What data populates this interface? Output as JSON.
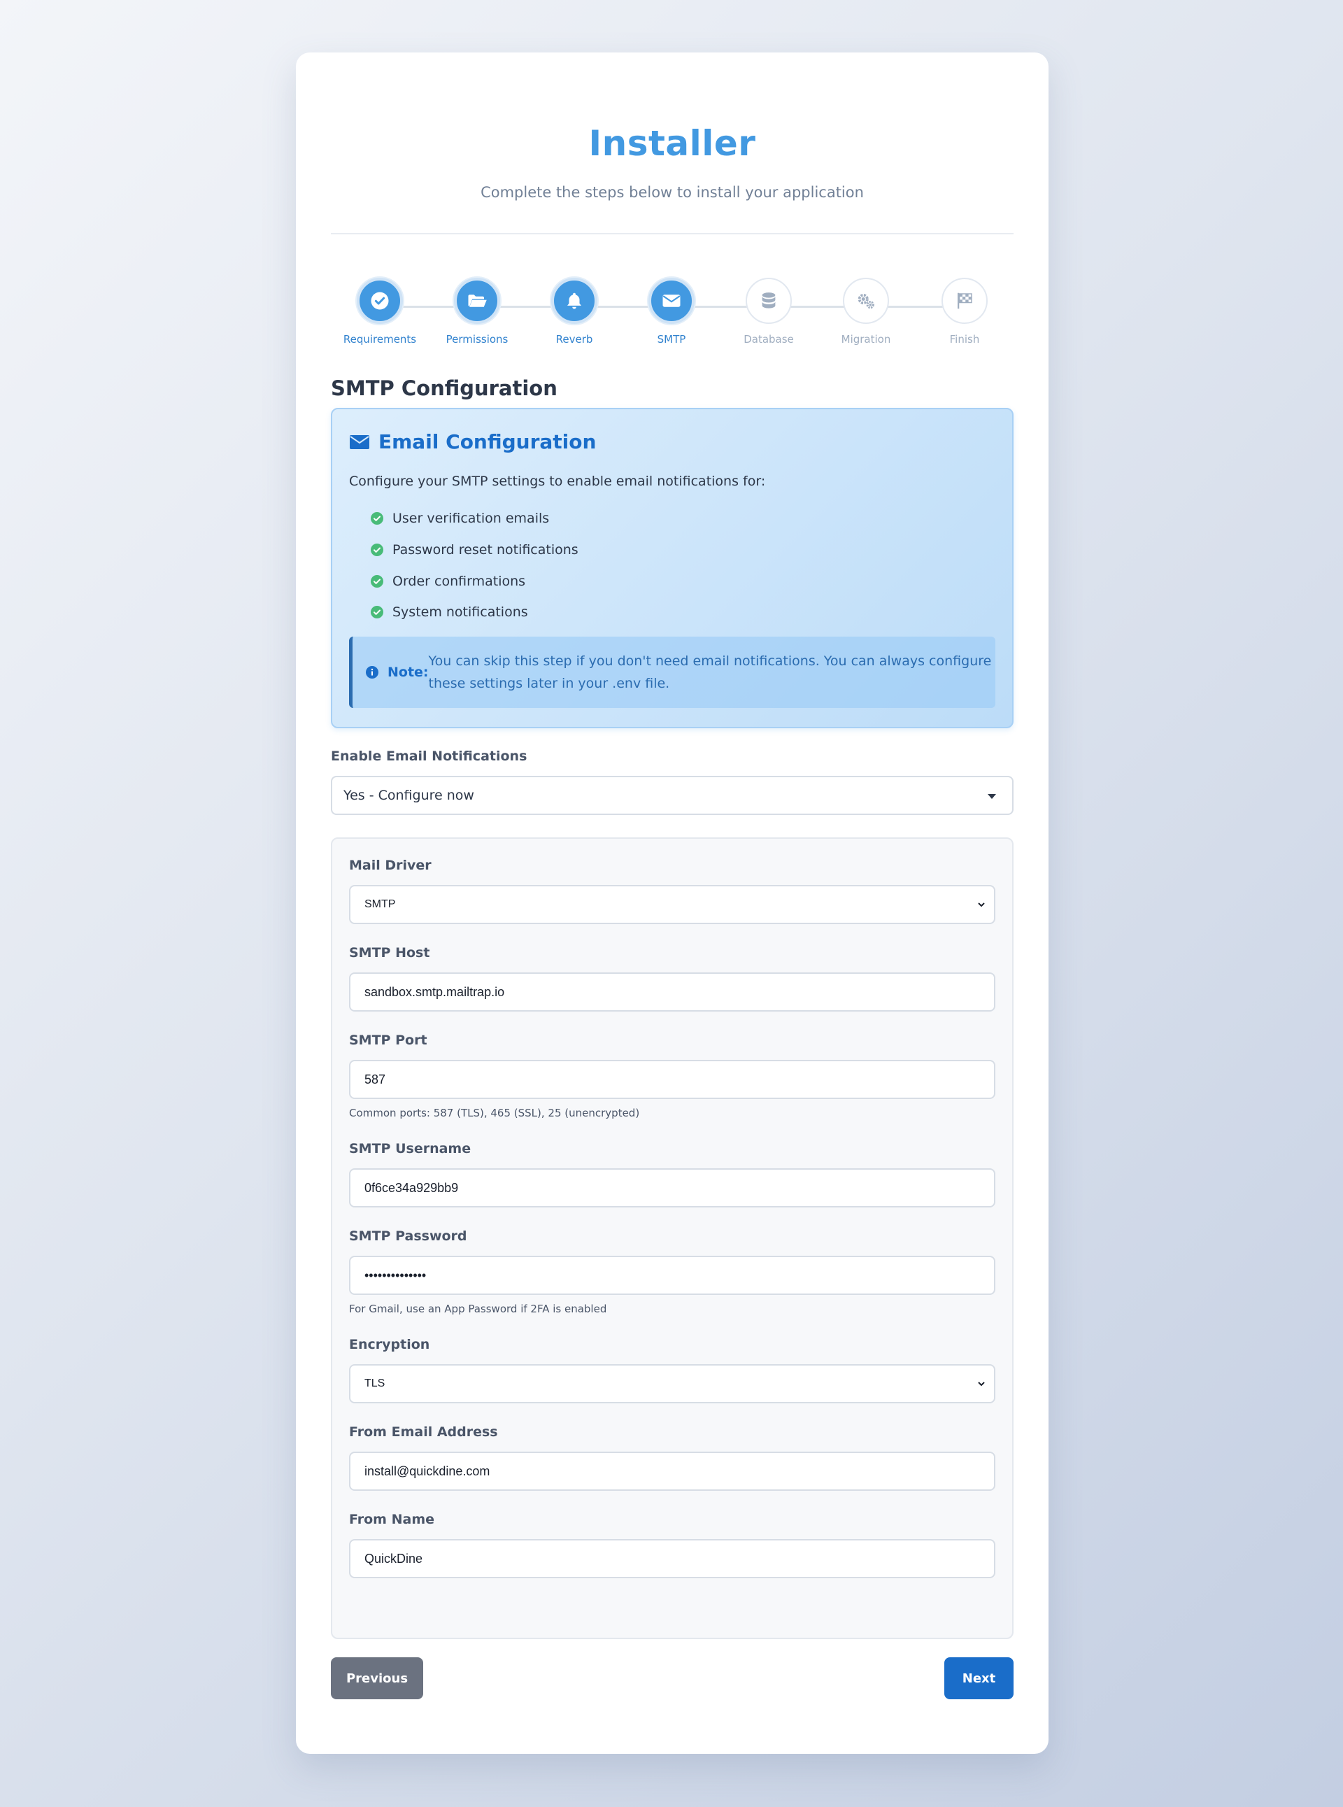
{
  "header": {
    "title": "Installer",
    "subtitle": "Complete the steps below to install your application"
  },
  "steps": [
    {
      "label": "Requirements",
      "icon": "check-circle-icon",
      "state": "done"
    },
    {
      "label": "Permissions",
      "icon": "folder-open-icon",
      "state": "done"
    },
    {
      "label": "Reverb",
      "icon": "bell-icon",
      "state": "done"
    },
    {
      "label": "SMTP",
      "icon": "envelope-icon",
      "state": "current"
    },
    {
      "label": "Database",
      "icon": "database-icon",
      "state": "todo"
    },
    {
      "label": "Migration",
      "icon": "cogs-icon",
      "state": "todo"
    },
    {
      "label": "Finish",
      "icon": "flag-checkered-icon",
      "state": "todo"
    }
  ],
  "section_title": "SMTP Configuration",
  "info": {
    "title": "Email Configuration",
    "description": "Configure your SMTP settings to enable email notifications for:",
    "features": [
      "User verification emails",
      "Password reset notifications",
      "Order confirmations",
      "System notifications"
    ],
    "note_label": "Note:",
    "note_text": "You can skip this step if you don't need email notifications. You can always configure these settings later in your .env file."
  },
  "enable": {
    "label": "Enable Email Notifications",
    "value": "Yes - Configure now"
  },
  "form": {
    "mail_driver": {
      "label": "Mail Driver",
      "value": "SMTP"
    },
    "smtp_host": {
      "label": "SMTP Host",
      "value": "sandbox.smtp.mailtrap.io"
    },
    "smtp_port": {
      "label": "SMTP Port",
      "value": "587",
      "hint": "Common ports: 587 (TLS), 465 (SSL), 25 (unencrypted)"
    },
    "smtp_username": {
      "label": "SMTP Username",
      "value": "0f6ce34a929bb9"
    },
    "smtp_password": {
      "label": "SMTP Password",
      "value": "••••••••••••••",
      "hint": "For Gmail, use an App Password if 2FA is enabled"
    },
    "encryption": {
      "label": "Encryption",
      "value": "TLS"
    },
    "from_email": {
      "label": "From Email Address",
      "value": "install@quickdine.com"
    },
    "from_name": {
      "label": "From Name",
      "value": "QuickDine"
    }
  },
  "actions": {
    "previous": "Previous",
    "next": "Next"
  },
  "colors": {
    "accent": "#4299e1",
    "primary_button": "#1a6dc9",
    "secondary_button": "#6b7280",
    "success": "#48bb78"
  }
}
